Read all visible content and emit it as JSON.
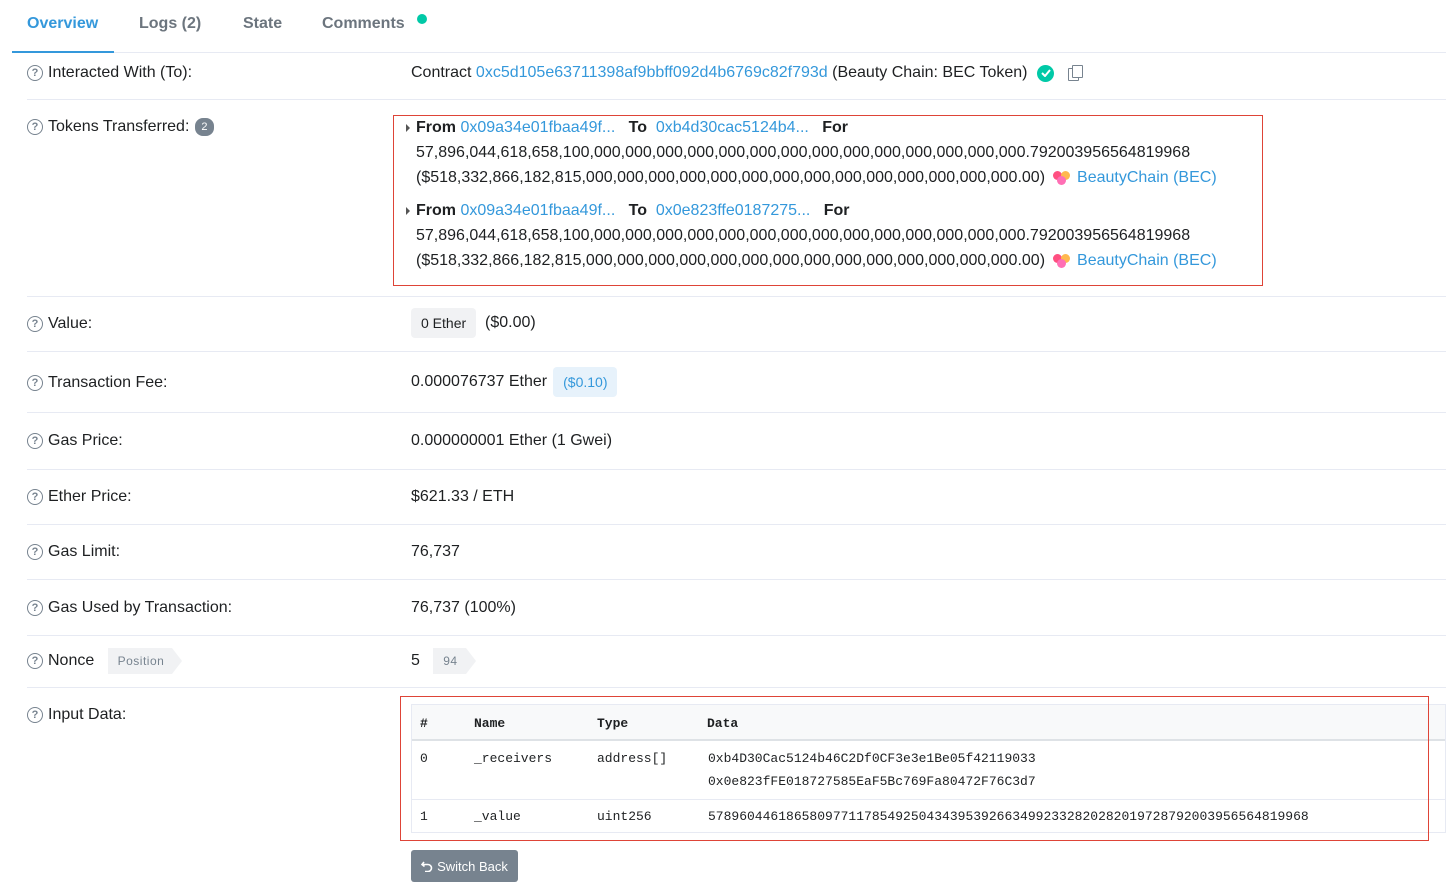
{
  "tabs": [
    {
      "label": "Overview"
    },
    {
      "label": "Logs (2)"
    },
    {
      "label": "State"
    },
    {
      "label": "Comments"
    }
  ],
  "interacted_with": {
    "label": "Interacted With (To):",
    "prefix": "Contract",
    "address": "0xc5d105e63711398af9bbff092d4b6769c82f793d",
    "name": "(Beauty Chain: BEC Token)"
  },
  "tokens_transferred": {
    "label": "Tokens Transferred:",
    "count": "2",
    "transfers": [
      {
        "from_label": "From",
        "from": "0x09a34e01fbaa49f...",
        "to_label": "To",
        "to": "0xb4d30cac5124b4...",
        "for_label": "For",
        "amount": "57,896,044,618,658,100,000,000,000,000,000,000,000,000,000,000,000,000,000,000.792003956564819968",
        "usd": "($518,332,866,182,815,000,000,000,000,000,000,000,000,000,000,000,000,000,000.00)",
        "token": "BeautyChain (BEC)"
      },
      {
        "from_label": "From",
        "from": "0x09a34e01fbaa49f...",
        "to_label": "To",
        "to": "0x0e823ffe0187275...",
        "for_label": "For",
        "amount": "57,896,044,618,658,100,000,000,000,000,000,000,000,000,000,000,000,000,000,000.792003956564819968",
        "usd": "($518,332,866,182,815,000,000,000,000,000,000,000,000,000,000,000,000,000,000.00)",
        "token": "BeautyChain (BEC)"
      }
    ]
  },
  "value": {
    "label": "Value:",
    "amount": "0 Ether",
    "usd": "($0.00)"
  },
  "fee": {
    "label": "Transaction Fee:",
    "amount": "0.000076737 Ether",
    "usd": "($0.10)"
  },
  "gas_price": {
    "label": "Gas Price:",
    "value": "0.000000001 Ether (1 Gwei)"
  },
  "ether_price": {
    "label": "Ether Price:",
    "value": "$621.33 / ETH"
  },
  "gas_limit": {
    "label": "Gas Limit:",
    "value": "76,737"
  },
  "gas_used": {
    "label": "Gas Used by Transaction:",
    "value": "76,737 (100%)"
  },
  "nonce": {
    "label": "Nonce",
    "tag": "Position",
    "value": "5",
    "position": "94"
  },
  "input_data": {
    "label": "Input Data:",
    "headers": [
      "#",
      "Name",
      "Type",
      "Data"
    ],
    "rows": [
      {
        "index": "0",
        "name": "_receivers",
        "type": "address[]",
        "data": [
          "0xb4D30Cac5124b46C2Df0CF3e3e1Be05f42119033",
          "0x0e823fFE018727585EaF5Bc769Fa80472F76C3d7"
        ]
      },
      {
        "index": "1",
        "name": "_value",
        "type": "uint256",
        "data": [
          "57896044618658097711785492504343953926634992332820282019728792003956564819968"
        ]
      }
    ],
    "switch_label": "Switch Back"
  },
  "colors": {
    "link": "#3498db",
    "highlight_border": "#de4437",
    "verified": "#00c9a7"
  }
}
